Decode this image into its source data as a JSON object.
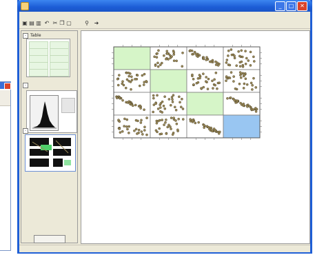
{
  "window": {
    "title": "",
    "controls": {
      "minimize": "_",
      "maximize": "□",
      "close": "✕"
    }
  },
  "menubar": [
    "",
    "",
    ""
  ],
  "toolbar": {
    "icons": [
      "save-icon",
      "open-icon",
      "print-icon",
      "undo-icon",
      "cut-icon",
      "copy-icon",
      "paste-icon",
      "pin-icon",
      "arrow-icon"
    ]
  },
  "left_panel": {
    "sections": [
      {
        "id": "table",
        "title": "Table"
      },
      {
        "id": "histogram",
        "title": ""
      },
      {
        "id": "scatter",
        "title": ""
      }
    ],
    "table_cells": [
      "",
      "",
      "",
      "",
      "",
      "",
      "",
      "",
      "",
      ""
    ],
    "button_label": ""
  },
  "splom": {
    "variables": [
      "",
      "",
      "",
      ""
    ],
    "colors": {
      "diagonal": "#d6f5c8",
      "selected": "#99c6f2",
      "points": "#9c8a58",
      "point_edge": "#3b3320"
    }
  },
  "statusbar": {
    "text": ""
  },
  "background_window": {
    "close_color": "#d9442b"
  }
}
